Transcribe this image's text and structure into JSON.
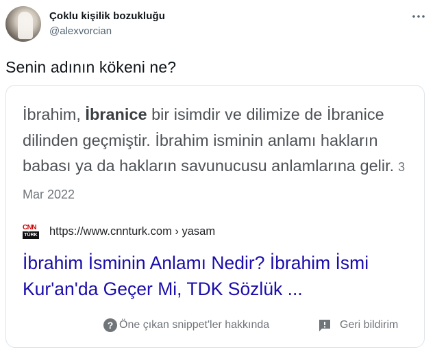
{
  "tweet": {
    "author": {
      "display_name": "Çoklu kişilik bozukluğu",
      "handle": "@alexvorcian"
    },
    "text": "Senin adının kökeni ne?"
  },
  "card": {
    "snippet": {
      "lead": "İbrahim, ",
      "bold": "İbranice",
      "rest": " bir isimdir ve dilimize de İbranice dilinden geçmiştir. İbrahim isminin anlamı hakların babası ya da hakların savunucusu anlamlarına gelir.",
      "date": "3 Mar 2022"
    },
    "source": {
      "logo_top": "CNN",
      "logo_bottom": "TÜRK",
      "url": "https://www.cnnturk.com › yasam"
    },
    "result_title": "İbrahim İsminin Anlamı Nedir? İbrahim İsmi Kur'an'da Geçer Mi, TDK Sözlük ...",
    "footer": {
      "about_label": "Öne çıkan snippet'ler hakkında",
      "feedback_label": "Geri bildirim"
    }
  },
  "colors": {
    "link": "#1a0dab",
    "secondary": "#70757a",
    "snippet": "#4d5156",
    "handle": "#536471"
  },
  "icons": [
    "more-icon",
    "help-icon",
    "feedback-icon"
  ]
}
